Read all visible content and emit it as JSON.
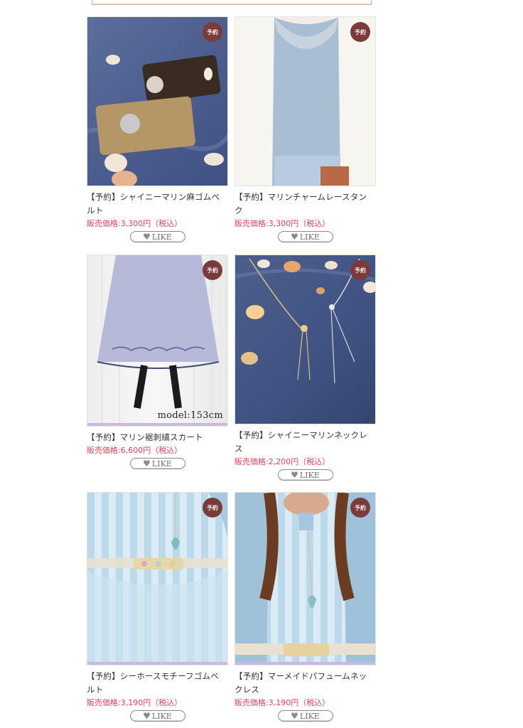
{
  "products": [
    {
      "badge": "予約",
      "name_line1": "【予約】シャイニーマリン麻ゴムベ",
      "name_line2": "ルト",
      "price": "販売価格:3,300円（税込）",
      "like": "LIKE"
    },
    {
      "badge": "予約",
      "name_line1": "【予約】マリンチャームレースタン",
      "name_line2": "ク",
      "price": "販売価格:3,300円（税込）",
      "like": "LIKE"
    },
    {
      "badge": "予約",
      "name_line1": "【予約】マリン裾刺繍スカート",
      "name_line2": "",
      "price": "販売価格:6,600円（税込）",
      "like": "LIKE",
      "photo_caption": "model:153cm"
    },
    {
      "badge": "予約",
      "name_line1": "【予約】シャイニーマリンネックレ",
      "name_line2": "ス",
      "price": "販売価格:2,200円（税込）",
      "like": "LIKE"
    },
    {
      "badge": "予約",
      "name_line1": "【予約】シーホースモチーフゴムベ",
      "name_line2": "ルト",
      "price": "販売価格:3,190円（税込）",
      "like": "LIKE"
    },
    {
      "badge": "予約",
      "name_line1": "【予約】マーメイドパフュームネッ",
      "name_line2": "クレス",
      "price": "販売価格:3,190円（税込）",
      "like": "LIKE"
    }
  ],
  "icons": {
    "like": "heart-icon"
  },
  "colors": {
    "price": "#d5455d",
    "badge": "#7a3b3b",
    "like_border": "#8a8a8a"
  }
}
